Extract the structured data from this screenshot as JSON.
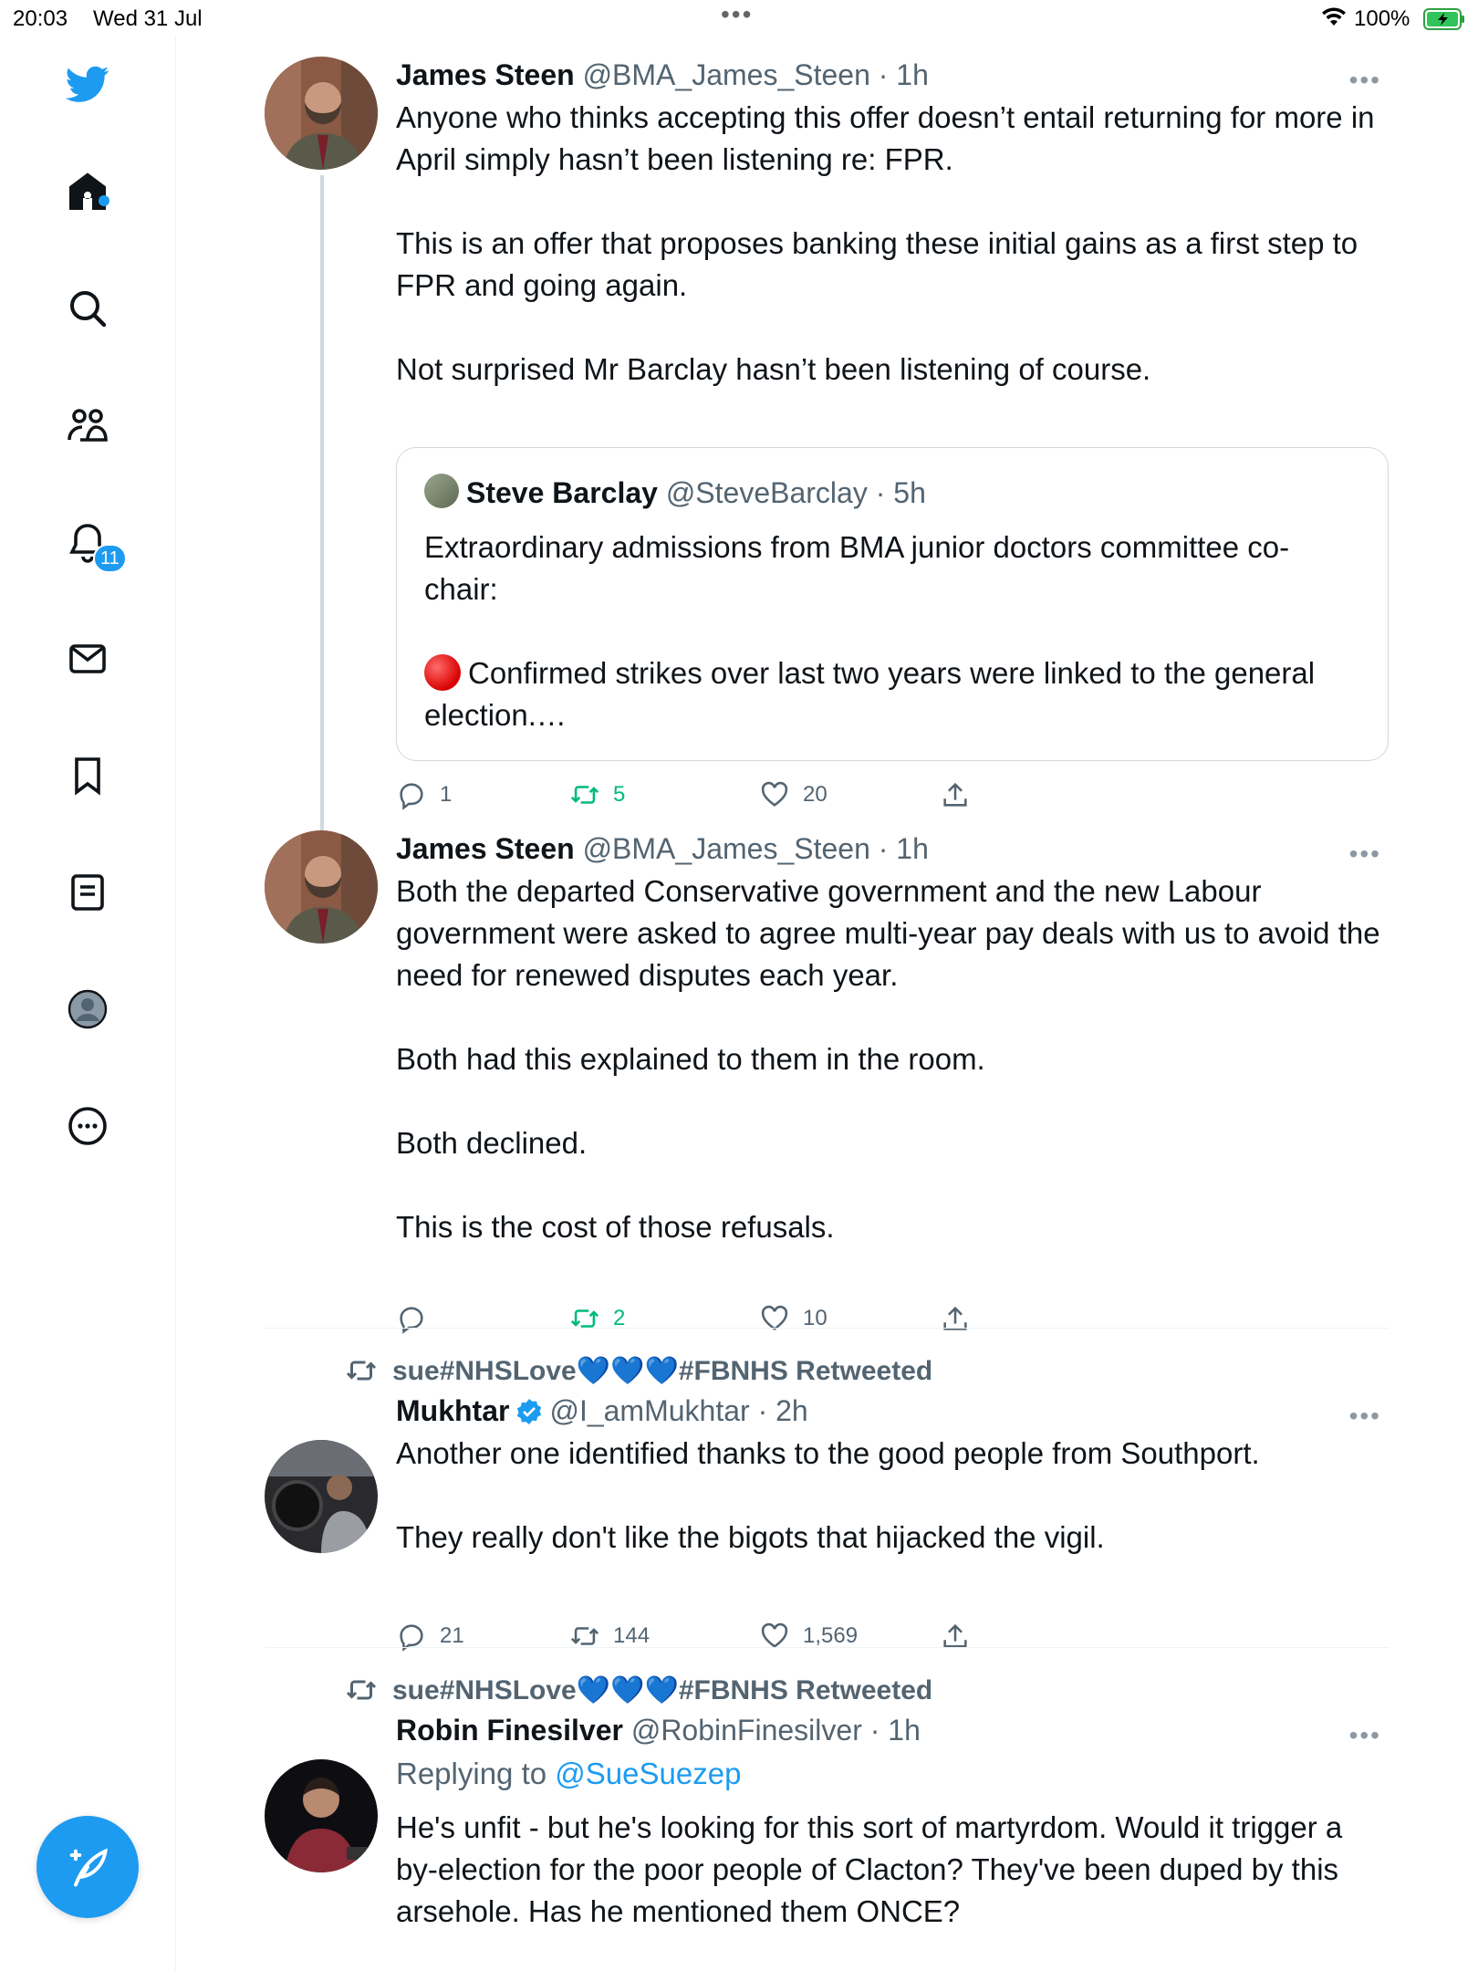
{
  "status_bar": {
    "time": "20:03",
    "date": "Wed 31 Jul",
    "dots": "•••",
    "battery": "100%"
  },
  "sidebar": {
    "notifications_badge": "11",
    "items": [
      "home-icon",
      "search-icon",
      "communities-icon",
      "notifications-icon",
      "messages-icon",
      "bookmarks-icon",
      "lists-icon",
      "profile-icon",
      "more-icon"
    ]
  },
  "colors": {
    "accent": "#1d9bf0",
    "retweet_green": "#00ba7c",
    "muted": "#536471"
  },
  "tweets": [
    {
      "name": "James Steen",
      "handle": "@BMA_James_Steen · 1h",
      "paragraphs": [
        "Anyone who thinks accepting this offer doesn’t entail returning for more in April simply hasn’t been listening re: FPR.",
        "This is an offer that proposes banking these initial gains as a first step to FPR and going again.",
        "Not surprised Mr Barclay hasn’t been listening of course."
      ],
      "quote": {
        "name": "Steve Barclay",
        "handle": "@SteveBarclay · 5h",
        "p1": "Extraordinary admissions from BMA junior doctors committee co-chair:",
        "p2": "Confirmed strikes over last two years were linked to the general election.…"
      },
      "replies": "1",
      "retweets": "5",
      "likes": "20"
    },
    {
      "name": "James Steen",
      "handle": "@BMA_James_Steen · 1h",
      "paragraphs": [
        "Both the departed Conservative government and the new Labour government were asked to agree multi-year pay deals with us to avoid the need for renewed disputes each year.",
        "Both had this explained to them in the room.",
        "Both declined.",
        "This is the cost of those refusals."
      ],
      "replies": "",
      "retweets": "2",
      "likes": "10"
    },
    {
      "retweeted_by_prefix": "sue#NHSLove",
      "retweeted_by_suffix": "#FBNHS Retweeted",
      "hearts": "💙💙💙",
      "name": "Mukhtar",
      "handle": "@I_amMukhtar · 2h",
      "paragraphs": [
        "Another one identified thanks to the good people from Southport.",
        "They really don't like the bigots that hijacked the vigil."
      ],
      "replies": "21",
      "retweets": "144",
      "likes": "1,569"
    },
    {
      "retweeted_by_prefix": "sue#NHSLove",
      "retweeted_by_suffix": "#FBNHS Retweeted",
      "hearts": "💙💙💙",
      "name": "Robin Finesilver",
      "handle": "@RobinFinesilver · 1h",
      "replying_to_label": "Replying to",
      "replying_to_handle": "@SueSuezep",
      "paragraphs": [
        "He's unfit - but he's looking for this sort of martyrdom. Would it trigger a by-election for the poor people of Clacton? They've been duped by this arsehole. Has he mentioned them ONCE?"
      ]
    }
  ]
}
